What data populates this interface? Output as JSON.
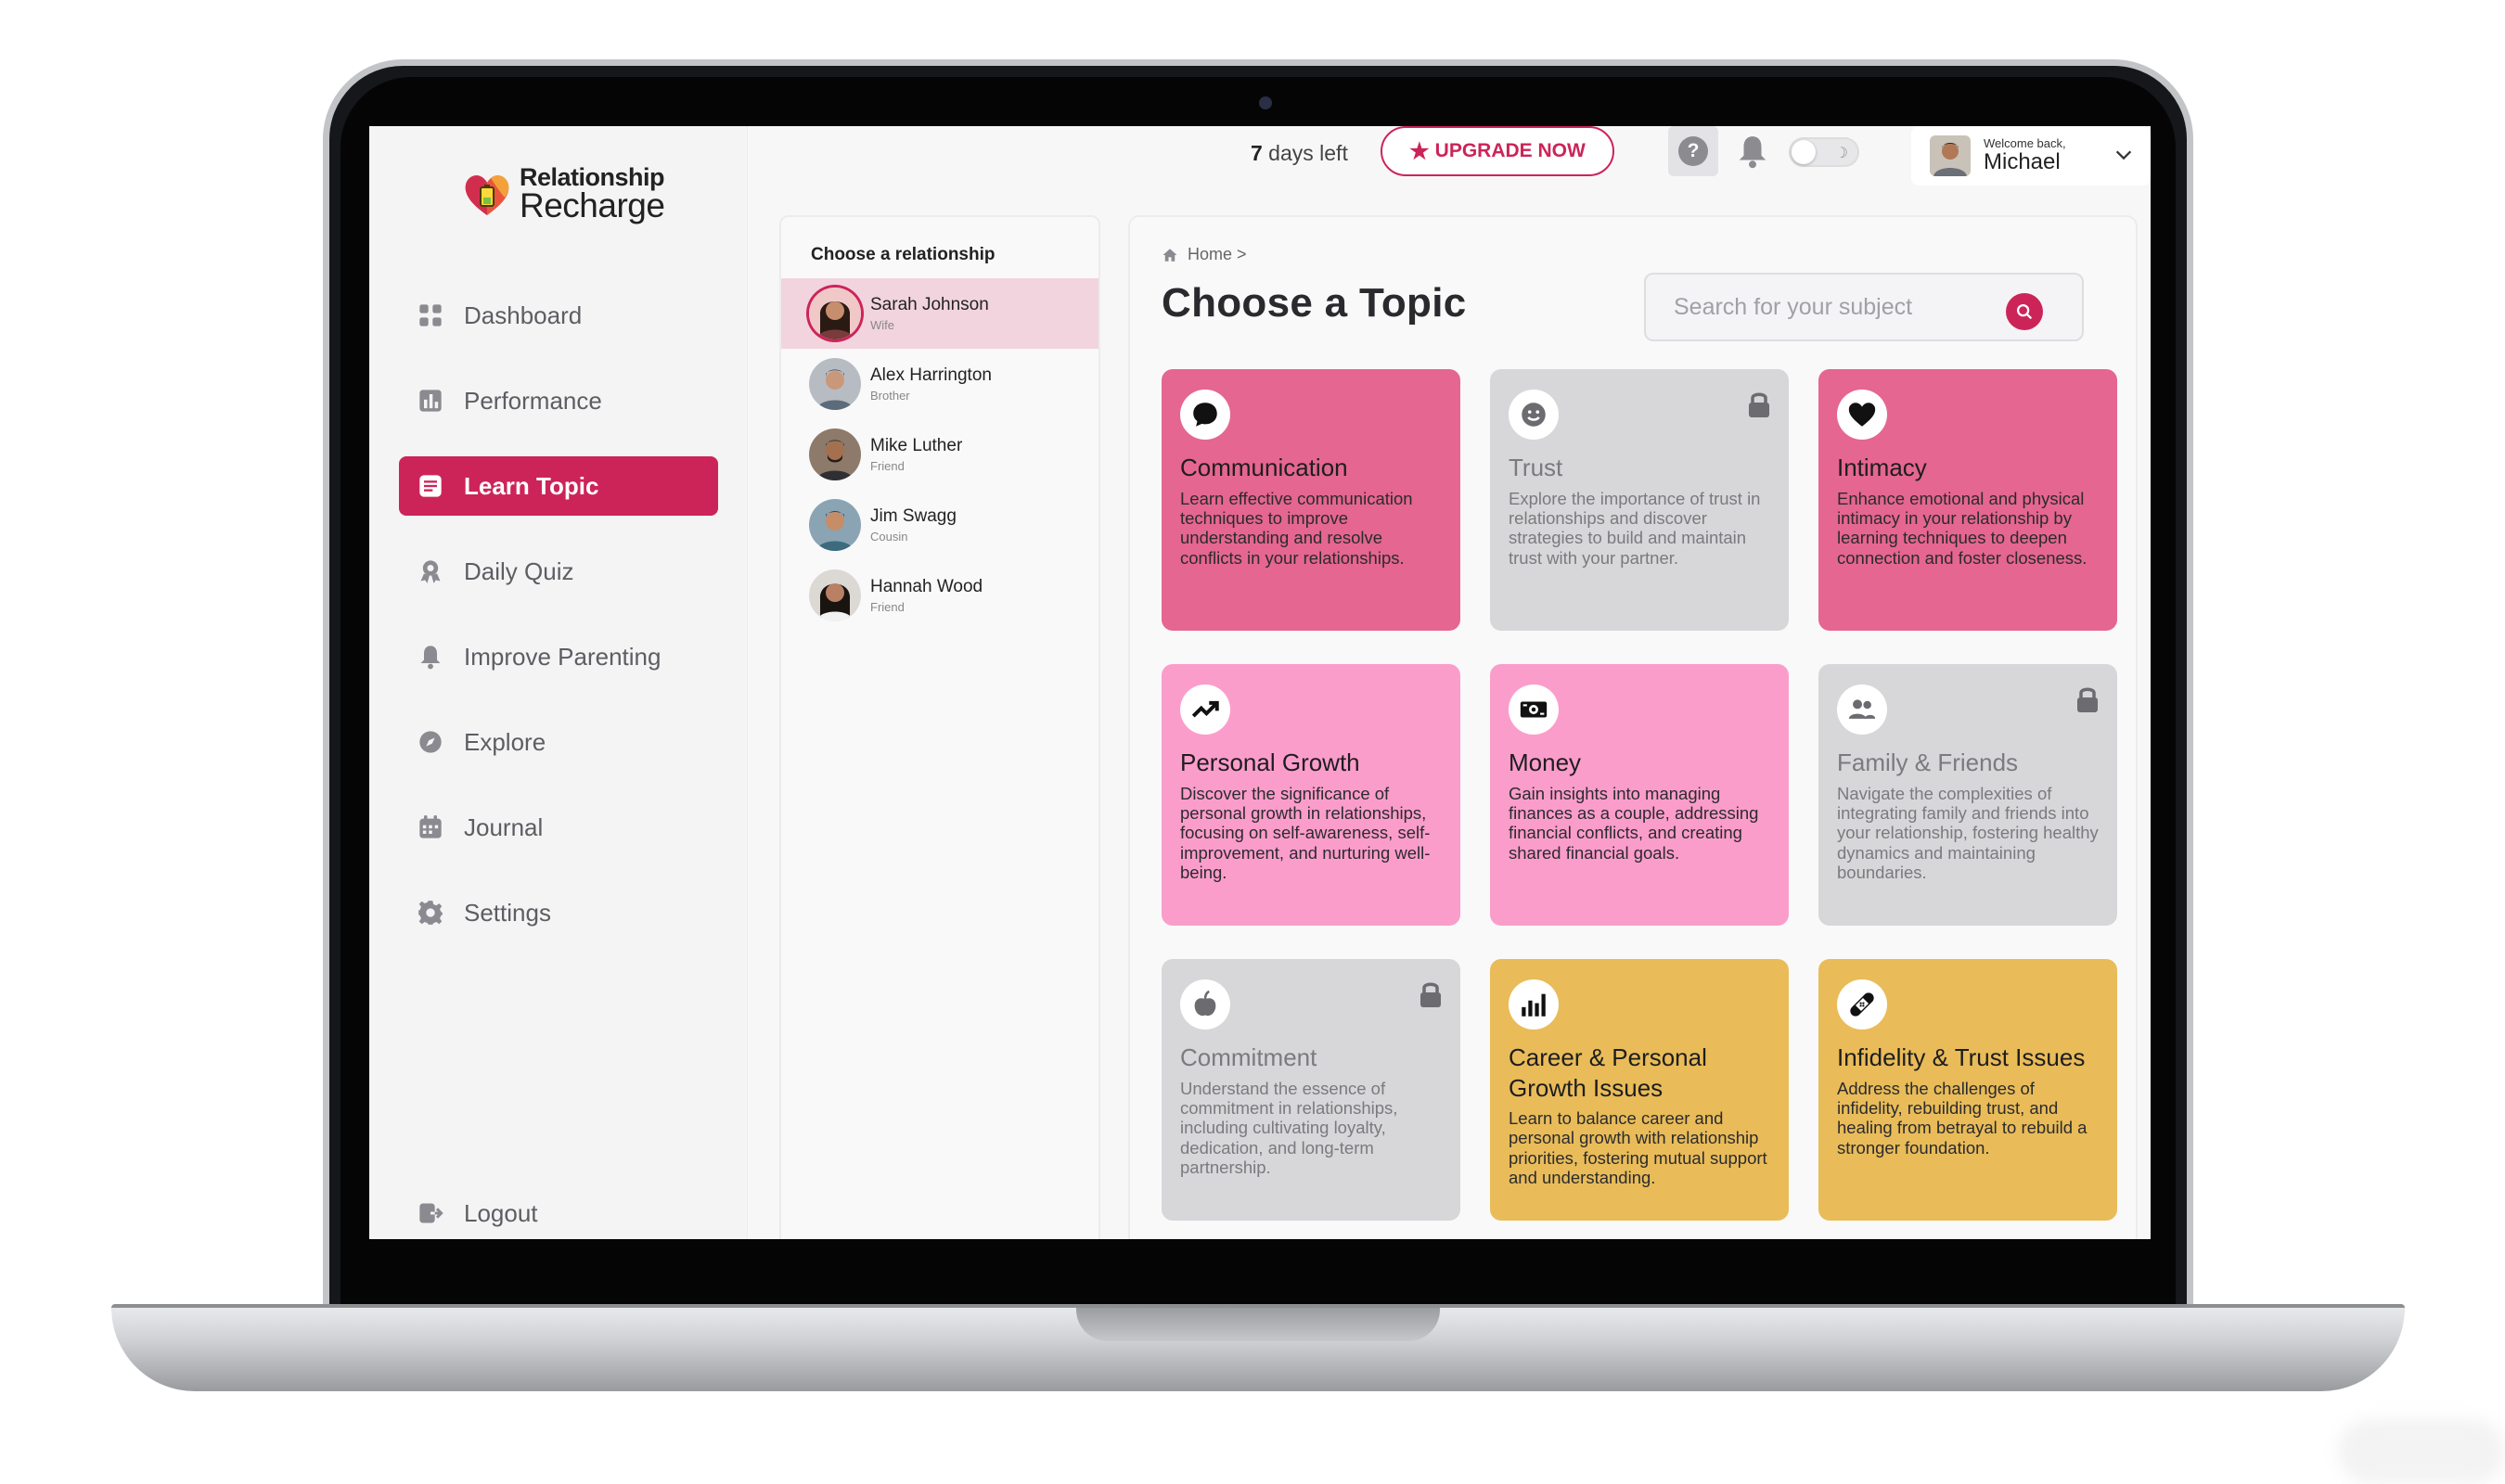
{
  "app": {
    "logo_line1": "Relationship",
    "logo_line2": "Recharge",
    "accent": "#cc2459"
  },
  "sidebar": {
    "items": [
      {
        "label": "Dashboard",
        "icon": "dashboard-grid-icon"
      },
      {
        "label": "Performance",
        "icon": "bar-chart-icon"
      },
      {
        "label": "Learn Topic",
        "icon": "book-icon",
        "active": true
      },
      {
        "label": "Daily Quiz",
        "icon": "badge-ribbon-icon"
      },
      {
        "label": "Improve Parenting",
        "icon": "bell-icon"
      },
      {
        "label": "Explore",
        "icon": "compass-icon"
      },
      {
        "label": "Journal",
        "icon": "calendar-icon"
      },
      {
        "label": "Settings",
        "icon": "gear-icon"
      }
    ],
    "logout": "Logout"
  },
  "topbar": {
    "days_count": "7",
    "days_text": " days left",
    "upgrade_label": "UPGRADE NOW",
    "help_glyph": "?",
    "welcome": "Welcome back,",
    "user_name": "Michael"
  },
  "relationships": {
    "title": "Choose a relationship",
    "items": [
      {
        "name": "Sarah Johnson",
        "role": "Wife",
        "active": true
      },
      {
        "name": "Alex Harrington",
        "role": "Brother"
      },
      {
        "name": "Mike Luther",
        "role": "Friend"
      },
      {
        "name": "Jim Swagg",
        "role": "Cousin"
      },
      {
        "name": "Hannah Wood",
        "role": "Friend"
      }
    ]
  },
  "main": {
    "breadcrumb": "Home >",
    "title": "Choose a Topic",
    "search_placeholder": "Search for your subject",
    "topics": [
      {
        "title": "Communication",
        "desc": "Learn effective communication techniques to improve understanding and resolve conflicts in your relationships.",
        "color": "#e56690",
        "icon": "chat-bubble-icon",
        "locked": false
      },
      {
        "title": "Trust",
        "desc": "Explore the importance of trust in relationships and discover strategies to build and maintain trust with your partner.",
        "color": "#d7d7d9",
        "icon": "smiley-icon",
        "locked": true
      },
      {
        "title": "Intimacy",
        "desc": "Enhance emotional and physical intimacy in your relationship by learning techniques to deepen connection and foster closeness.",
        "color": "#e56690",
        "icon": "heart-icon",
        "locked": false
      },
      {
        "title": "Personal Growth",
        "desc": "Discover the significance of personal growth in relationships, focusing on self-awareness, self-improvement, and nurturing well-being.",
        "color": "#fb9dcb",
        "icon": "trending-up-icon",
        "locked": false
      },
      {
        "title": "Money",
        "desc": "Gain insights into managing finances as a couple, addressing financial conflicts, and creating shared financial goals.",
        "color": "#fb9dcb",
        "icon": "banknote-icon",
        "locked": false
      },
      {
        "title": "Family & Friends",
        "desc": "Navigate the complexities of integrating family and friends into your relationship, fostering healthy dynamics and maintaining boundaries.",
        "color": "#d7d7d9",
        "icon": "people-icon",
        "locked": true
      },
      {
        "title": "Commitment",
        "desc": "Understand the essence of commitment in relationships, including cultivating loyalty, dedication, and long-term partnership.",
        "color": "#d7d7d9",
        "icon": "apple-icon",
        "locked": true
      },
      {
        "title": "Career & Personal Growth Issues",
        "desc": "Learn to balance career and personal growth with relationship priorities, fostering mutual support and understanding.",
        "color": "#e9bc59",
        "icon": "bar-graph-icon",
        "locked": false
      },
      {
        "title": "Infidelity & Trust Issues",
        "desc": "Address the challenges of infidelity, rebuilding trust, and healing from betrayal to rebuild a stronger foundation.",
        "color": "#e9bc59",
        "icon": "bandage-icon",
        "locked": false
      }
    ]
  }
}
